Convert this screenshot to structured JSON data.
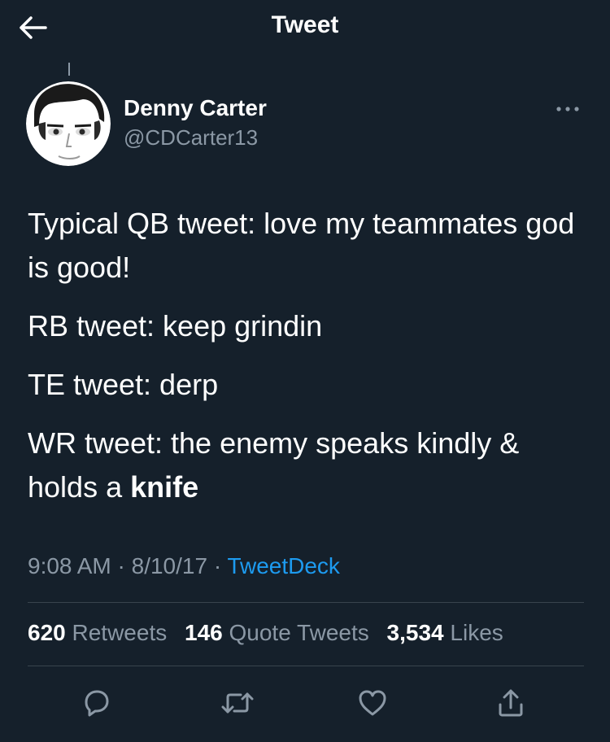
{
  "header": {
    "title": "Tweet",
    "back_icon": "arrow-left-icon"
  },
  "author": {
    "name": "Denny Carter",
    "handle": "@CDCarter13"
  },
  "tweet": {
    "lines": [
      "Typical QB tweet: love my teammates god is good!",
      "RB tweet: keep grindin",
      "TE tweet: derp"
    ],
    "last_line_prefix": "WR tweet: the enemy speaks kindly & holds a ",
    "last_line_bold": "knife"
  },
  "meta": {
    "time": "9:08 AM",
    "separator": "·",
    "date": "8/10/17",
    "source": "TweetDeck"
  },
  "stats": {
    "retweets": {
      "count": "620",
      "label": "Retweets"
    },
    "quotes": {
      "count": "146",
      "label": "Quote Tweets"
    },
    "likes": {
      "count": "3,534",
      "label": "Likes"
    }
  },
  "actions": [
    "reply-icon",
    "retweet-icon",
    "like-icon",
    "share-icon"
  ],
  "colors": {
    "background": "#15202b",
    "secondary_text": "#8b98a5",
    "link": "#1d9bf0",
    "divider": "#38444d"
  }
}
